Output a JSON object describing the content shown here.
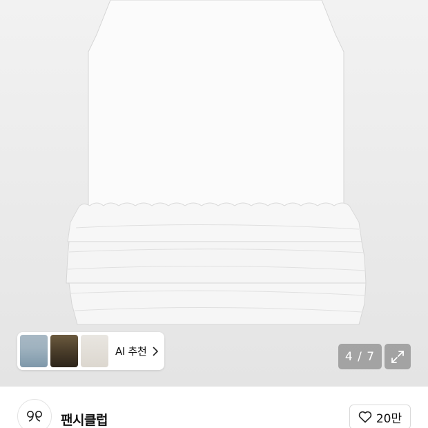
{
  "product": {
    "image_alt": "white sleeveless dress with ruffled tiered hem",
    "image_counter": "4 / 7"
  },
  "ai_recommend": {
    "label": "AI 추천",
    "thumbnails": [
      "look-thumbnail-1",
      "look-thumbnail-2",
      "look-thumbnail-3"
    ],
    "chevron_icon": "chevron-right-icon"
  },
  "controls": {
    "expand_icon": "expand-icon"
  },
  "store": {
    "name": "팬시클럽",
    "logo_icon": "fancyclub-logo-icon",
    "like_icon": "heart-icon",
    "like_count": "20만"
  },
  "colors": {
    "image_bg": "#ececec",
    "overlay": "#6e6e6e",
    "text": "#111111"
  }
}
